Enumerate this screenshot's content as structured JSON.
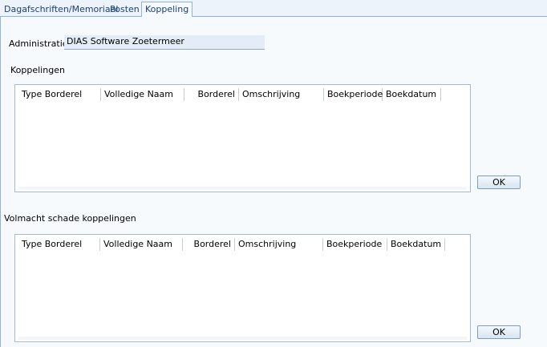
{
  "tabs": [
    {
      "label": "Dagafschriften/Memoriaal"
    },
    {
      "label": "Posten"
    },
    {
      "label": "Koppeling"
    }
  ],
  "administratie": {
    "label": "Administratie",
    "value": "DIAS Software Zoetermeer"
  },
  "koppelingen": {
    "title": "Koppelingen",
    "columns": [
      "Type Borderel",
      "Volledige Naam",
      "Borderel",
      "Omschrijving",
      "Boekperiode",
      "Boekdatum"
    ],
    "ok_label": "OK"
  },
  "volmacht": {
    "title": "Volmacht schade koppelingen",
    "columns": [
      "Type Borderel",
      "Volledige Naam",
      "Borderel",
      "Omschrijving",
      "Boekperiode",
      "Boekdatum"
    ],
    "ok_label": "OK"
  }
}
